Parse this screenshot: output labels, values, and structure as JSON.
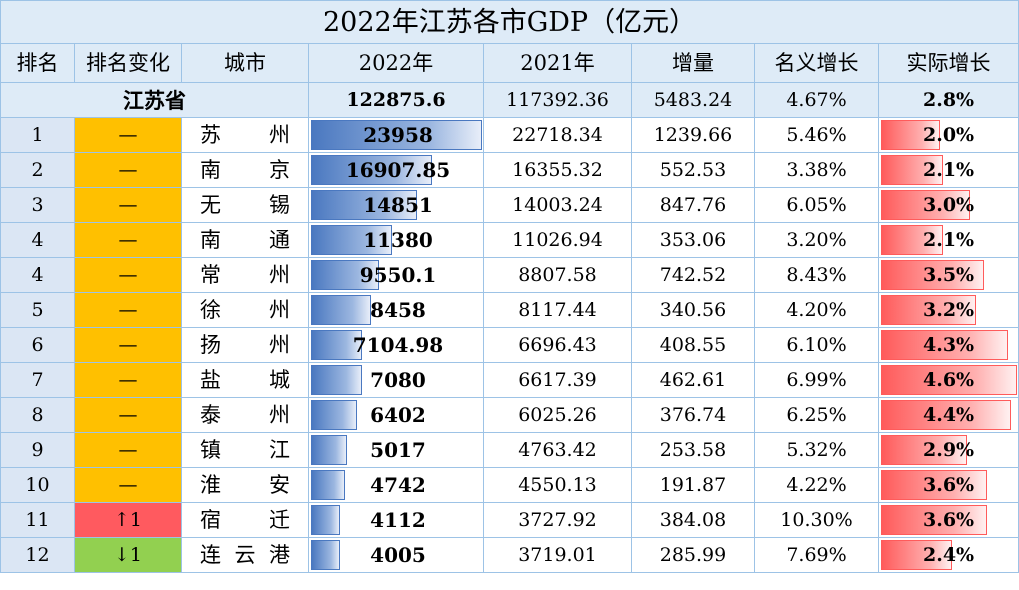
{
  "title": "2022年江苏各市GDP（亿元）",
  "headers": [
    "排名",
    "排名变化",
    "城市",
    "2022年",
    "2021年",
    "增量",
    "名义增长",
    "实际增长"
  ],
  "province": {
    "name": "江苏省",
    "gdp2022": "122875.6",
    "gdp2021": "117392.36",
    "increase": "5483.24",
    "nominal": "4.67%",
    "real": "2.8%"
  },
  "colors": {
    "header_bg": "#deebf7",
    "rank_unchanged": "#ffc000",
    "rank_up": "#ff5a5f",
    "rank_down": "#92d050",
    "gdp_bar": "#4a78c0",
    "real_bar": "#ff5b5b"
  },
  "chart_data": {
    "type": "table",
    "title": "2022年江苏各市GDP（亿元）",
    "columns": [
      "排名",
      "排名变化",
      "城市",
      "2022年",
      "2021年",
      "增量",
      "名义增长",
      "实际增长"
    ],
    "rows": [
      {
        "rank": "1",
        "change": "—",
        "change_dir": "same",
        "city": [
          "苏",
          "州"
        ],
        "gdp2022": "23958",
        "gdp2022_value": 23958,
        "gdp2021": "22718.34",
        "increase": "1239.66",
        "nominal": "5.46%",
        "real": "2.0%",
        "real_value": 2.0
      },
      {
        "rank": "2",
        "change": "—",
        "change_dir": "same",
        "city": [
          "南",
          "京"
        ],
        "gdp2022": "16907.85",
        "gdp2022_value": 16907.85,
        "gdp2021": "16355.32",
        "increase": "552.53",
        "nominal": "3.38%",
        "real": "2.1%",
        "real_value": 2.1
      },
      {
        "rank": "3",
        "change": "—",
        "change_dir": "same",
        "city": [
          "无",
          "锡"
        ],
        "gdp2022": "14851",
        "gdp2022_value": 14851,
        "gdp2021": "14003.24",
        "increase": "847.76",
        "nominal": "6.05%",
        "real": "3.0%",
        "real_value": 3.0
      },
      {
        "rank": "4",
        "change": "—",
        "change_dir": "same",
        "city": [
          "南",
          "通"
        ],
        "gdp2022": "11380",
        "gdp2022_value": 11380,
        "gdp2021": "11026.94",
        "increase": "353.06",
        "nominal": "3.20%",
        "real": "2.1%",
        "real_value": 2.1
      },
      {
        "rank": "4",
        "change": "—",
        "change_dir": "same",
        "city": [
          "常",
          "州"
        ],
        "gdp2022": "9550.1",
        "gdp2022_value": 9550.1,
        "gdp2021": "8807.58",
        "increase": "742.52",
        "nominal": "8.43%",
        "real": "3.5%",
        "real_value": 3.5
      },
      {
        "rank": "5",
        "change": "—",
        "change_dir": "same",
        "city": [
          "徐",
          "州"
        ],
        "gdp2022": "8458",
        "gdp2022_value": 8458,
        "gdp2021": "8117.44",
        "increase": "340.56",
        "nominal": "4.20%",
        "real": "3.2%",
        "real_value": 3.2
      },
      {
        "rank": "6",
        "change": "—",
        "change_dir": "same",
        "city": [
          "扬",
          "州"
        ],
        "gdp2022": "7104.98",
        "gdp2022_value": 7104.98,
        "gdp2021": "6696.43",
        "increase": "408.55",
        "nominal": "6.10%",
        "real": "4.3%",
        "real_value": 4.3
      },
      {
        "rank": "7",
        "change": "—",
        "change_dir": "same",
        "city": [
          "盐",
          "城"
        ],
        "gdp2022": "7080",
        "gdp2022_value": 7080,
        "gdp2021": "6617.39",
        "increase": "462.61",
        "nominal": "6.99%",
        "real": "4.6%",
        "real_value": 4.6
      },
      {
        "rank": "8",
        "change": "—",
        "change_dir": "same",
        "city": [
          "泰",
          "州"
        ],
        "gdp2022": "6402",
        "gdp2022_value": 6402,
        "gdp2021": "6025.26",
        "increase": "376.74",
        "nominal": "6.25%",
        "real": "4.4%",
        "real_value": 4.4
      },
      {
        "rank": "9",
        "change": "—",
        "change_dir": "same",
        "city": [
          "镇",
          "江"
        ],
        "gdp2022": "5017",
        "gdp2022_value": 5017,
        "gdp2021": "4763.42",
        "increase": "253.58",
        "nominal": "5.32%",
        "real": "2.9%",
        "real_value": 2.9
      },
      {
        "rank": "10",
        "change": "—",
        "change_dir": "same",
        "city": [
          "淮",
          "安"
        ],
        "gdp2022": "4742",
        "gdp2022_value": 4742,
        "gdp2021": "4550.13",
        "increase": "191.87",
        "nominal": "4.22%",
        "real": "3.6%",
        "real_value": 3.6
      },
      {
        "rank": "11",
        "change": "↑1",
        "change_dir": "up",
        "city": [
          "宿",
          "迁"
        ],
        "gdp2022": "4112",
        "gdp2022_value": 4112,
        "gdp2021": "3727.92",
        "increase": "384.08",
        "nominal": "10.30%",
        "real": "3.6%",
        "real_value": 3.6
      },
      {
        "rank": "12",
        "change": "↓1",
        "change_dir": "down",
        "city": [
          "连",
          "云",
          "港"
        ],
        "gdp2022": "4005",
        "gdp2022_value": 4005,
        "gdp2021": "3719.01",
        "increase": "285.99",
        "nominal": "7.69%",
        "real": "2.4%",
        "real_value": 2.4
      }
    ],
    "gdp_bar_max": 23958,
    "real_bar_max": 4.6
  }
}
